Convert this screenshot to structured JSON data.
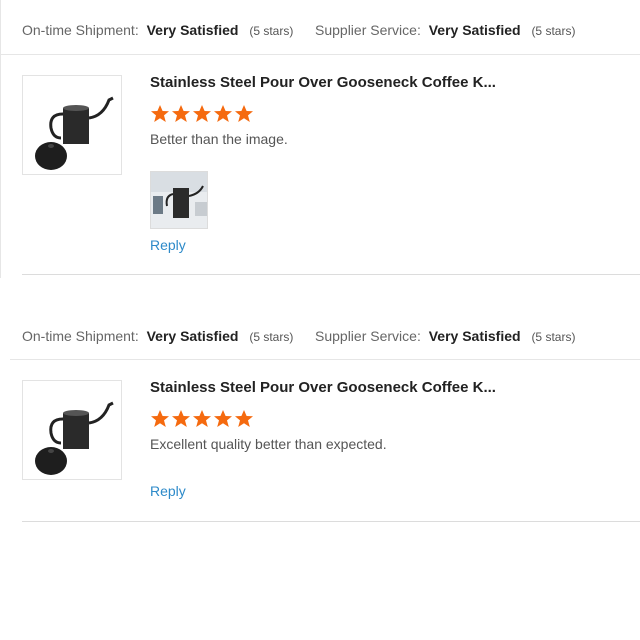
{
  "reviews": [
    {
      "ratings": [
        {
          "label": "On-time Shipment:",
          "value": "Very Satisfied",
          "stars": "(5 stars)"
        },
        {
          "label": "Supplier Service:",
          "value": "Very Satisfied",
          "stars": "(5 stars)"
        }
      ],
      "product_title": "Stainless Steel Pour Over Gooseneck Coffee K...",
      "rating": 5,
      "comment": "Better than the image.",
      "reply_label": "Reply",
      "has_photo": true
    },
    {
      "ratings": [
        {
          "label": "On-time Shipment:",
          "value": "Very Satisfied",
          "stars": "(5 stars)"
        },
        {
          "label": "Supplier Service:",
          "value": "Very Satisfied",
          "stars": "(5 stars)"
        }
      ],
      "product_title": "Stainless Steel Pour Over Gooseneck Coffee K...",
      "rating": 5,
      "comment": "Excellent quality better than expected.",
      "reply_label": "Reply",
      "has_photo": false
    }
  ],
  "colors": {
    "star": "#f56a0f",
    "link": "#2d8ac9"
  },
  "icons": {
    "rating": "star-icon",
    "product": "gooseneck-kettle-image"
  }
}
